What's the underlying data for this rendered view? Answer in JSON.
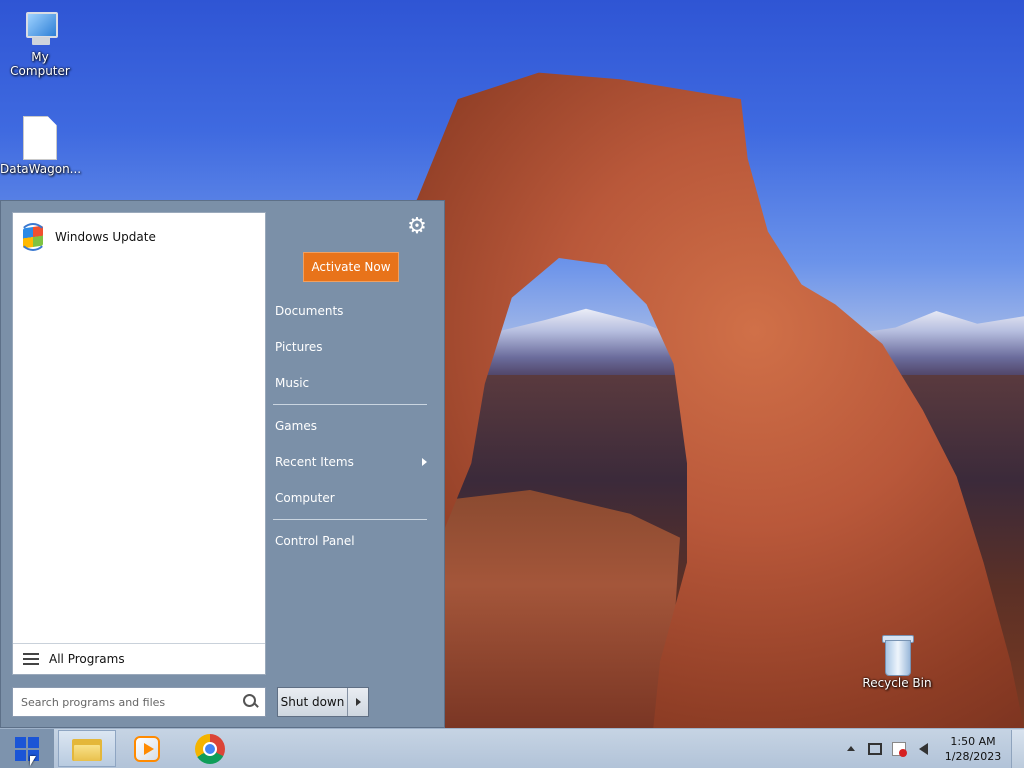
{
  "desktop": {
    "icons": [
      {
        "label": "My Computer"
      },
      {
        "label": "DataWagon..."
      },
      {
        "label": "Recycle Bin"
      }
    ]
  },
  "start_menu": {
    "programs": [
      {
        "label": "Windows Update",
        "icon": "windows-update-icon"
      }
    ],
    "all_programs_label": "All Programs",
    "search_placeholder": "Search programs and files",
    "settings_icon": "gear-icon",
    "activate_label": "Activate Now",
    "activate_color": "#e8731a",
    "links": [
      {
        "label": "Documents"
      },
      {
        "label": "Pictures"
      },
      {
        "label": "Music"
      },
      {
        "label": "Games"
      },
      {
        "label": "Recent Items"
      },
      {
        "label": "Computer"
      },
      {
        "label": "Control Panel"
      }
    ],
    "shutdown_label": "Shut down"
  },
  "taskbar": {
    "pinned": [
      {
        "name": "file-explorer-icon",
        "active": true
      },
      {
        "name": "media-player-icon",
        "active": false
      },
      {
        "name": "chrome-icon",
        "active": false
      }
    ],
    "tray": {
      "time": "1:50 AM",
      "date": "1/28/2023"
    }
  }
}
